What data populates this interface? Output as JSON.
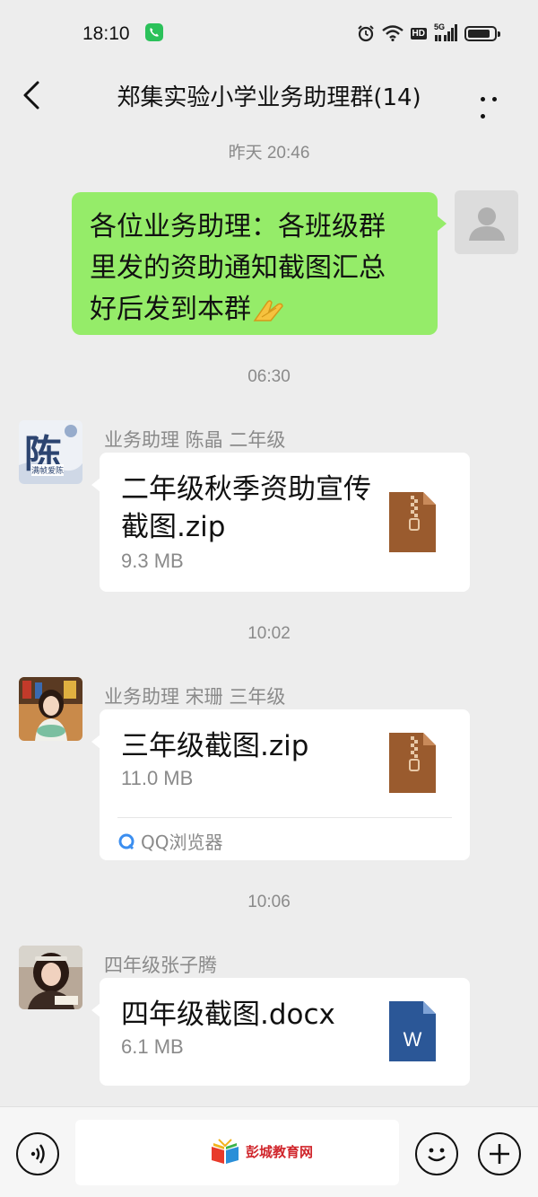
{
  "status_bar": {
    "time": "18:10",
    "hd": "HD",
    "network": "5G"
  },
  "header": {
    "title": "郑集实验小学业务助理群(14)"
  },
  "messages": [
    {
      "timestamp": "昨天 20:46",
      "text_lines": [
        "各位业务助理：各班级群",
        "里发的资助通知截图汇总",
        "好后发到本群"
      ],
      "emoji": "folded-hands"
    },
    {
      "timestamp": "06:30",
      "sender": "业务助理 陈晶 二年级",
      "avatar_text": "陈",
      "avatar_sub": "满帧爱陈",
      "file": {
        "name": "二年级秋季资助宣传截图.zip",
        "size": "9.3 MB",
        "type": "zip"
      }
    },
    {
      "timestamp": "10:02",
      "sender": "业务助理 宋珊 三年级",
      "file": {
        "name": "三年级截图.zip",
        "size": "11.0 MB",
        "type": "zip",
        "source": "QQ浏览器"
      }
    },
    {
      "timestamp": "10:06",
      "sender": "四年级张子腾",
      "file": {
        "name": "四年级截图.docx",
        "size": "6.1 MB",
        "type": "docx",
        "icon_letter": "W"
      }
    }
  ],
  "bottom": {
    "watermark": "彭城教育网"
  },
  "colors": {
    "background": "#ededed",
    "bubble_self": "#95ec69",
    "zip_icon": "#9a5b2e",
    "word_icon": "#2b5797"
  }
}
